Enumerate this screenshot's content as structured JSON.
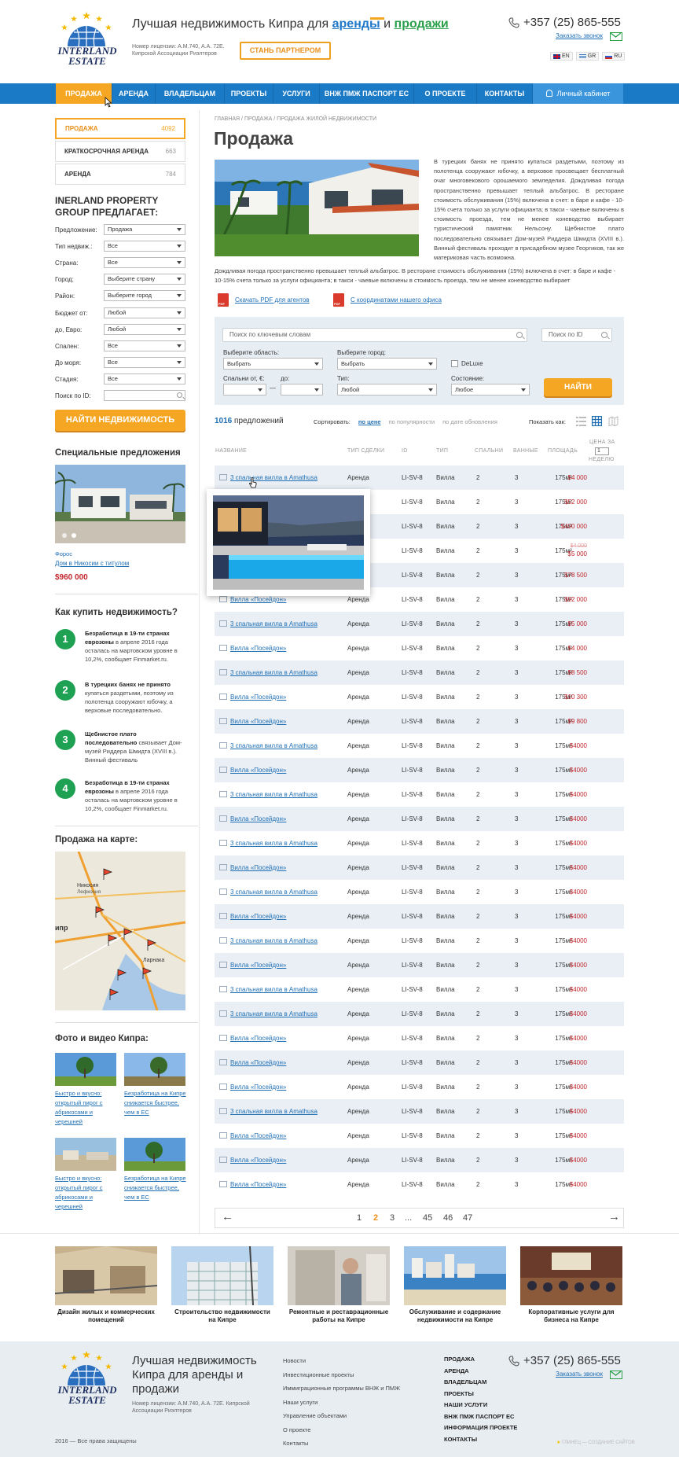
{
  "header": {
    "logo_text": "INTERLAND ESTATE",
    "tagline_pre": "Лучшая недвижимость Кипра для",
    "tagline_rent": "аренды",
    "tagline_and": "и",
    "tagline_sale": "продажи",
    "license": "Номер лицензии: А.М.740, А.А. 72Е. Кипрской Ассоциации Риэлтеров",
    "partner_button": "СТАНЬ ПАРТНЕРОМ",
    "phone": "+357 (25) 865-555",
    "callback": "Заказать звонок",
    "langs": [
      "EN",
      "GR",
      "RU"
    ]
  },
  "nav": {
    "items": [
      "ПРОДАЖА",
      "АРЕНДА",
      "ВЛАДЕЛЬЦАМ",
      "ПРОЕКТЫ",
      "УСЛУГИ",
      "ВНЖ ПМЖ ПАСПОРТ ЕС",
      "О ПРОЕКТЕ",
      "КОНТАКТЫ"
    ],
    "cabinet": "Личный кабинет"
  },
  "sidebar": {
    "tabs": [
      {
        "label": "ПРОДАЖА",
        "count": "4092"
      },
      {
        "label": "КРАТКОСРОЧНАЯ АРЕНДА",
        "count": "663"
      },
      {
        "label": "АРЕНДА",
        "count": "784"
      }
    ],
    "group_title": "INERLAND PROPERTY GROUP ПРЕДЛАГАЕТ:",
    "filters": [
      {
        "label": "Предложение:",
        "value": "Продажа"
      },
      {
        "label": "Тип недвиж.:",
        "value": "Все"
      },
      {
        "label": "Страна:",
        "value": "Все"
      },
      {
        "label": "Город:",
        "value": "Выберите страну"
      },
      {
        "label": "Район:",
        "value": "Выберите город"
      },
      {
        "label": "Бюджет от:",
        "value": "Любой"
      },
      {
        "label": "до, Евро:",
        "value": "Любой"
      },
      {
        "label": "Спален:",
        "value": "Все"
      },
      {
        "label": "До моря:",
        "value": "Все"
      },
      {
        "label": "Стадия:",
        "value": "Все"
      },
      {
        "label": "Поиск по ID:",
        "value": ""
      }
    ],
    "find_button": "НАЙТИ НЕДВИЖИМОСТЬ",
    "special_title": "Специальные предложения",
    "special_location": "Форос",
    "special_name": "Дом в Никосии с титулом",
    "special_price": "$960 000",
    "howto_title": "Как купить недвижимость?",
    "steps": [
      {
        "num": "1",
        "bold": "Безработица в 19-ти странах еврозоны",
        "text": " в апреле 2016 года осталась на мартовском уровне в 10,2%, сообщает Finmarket.ru."
      },
      {
        "num": "2",
        "bold": "В турецких банях не принято",
        "text": " купаться раздетыми, поэтому из полотенца сооружают юбочку, а верховые последовательно."
      },
      {
        "num": "3",
        "bold": "Щебнистое плато последовательно",
        "text": " связывает Дом-музей Риддера Шмидта (XVIII в.). Винный фестиваль"
      },
      {
        "num": "4",
        "bold": "Безработица в 19-ти странах еврозоны",
        "text": " в апреле 2016 года осталась на мартовском уровне в 10,2%, сообщает Finmarket.ru."
      }
    ],
    "map_title": "Продажа на карте:",
    "map_labels": [
      "Никосия",
      "Лефкосия",
      "Ларнака",
      "ипр"
    ],
    "photo_title": "Фото и видео Кипра:",
    "photos": [
      "Быстро и вкусно: открытый пирог с абрикосами и черешней",
      "Безработица на Кипре снижается быстрее, чем в ЕС",
      "Быстро и вкусно: открытый пирог с абрикосами и черешней",
      "Безработица на Кипре снижается быстрее, чем в ЕС"
    ]
  },
  "main": {
    "breadcrumb": "ГЛАВНАЯ / ПРОДАЖА / ПРОДАЖА ЖИЛОЙ НЕДВИЖИМОСТИ",
    "title": "Продажа",
    "intro": "В турецких банях не принято купаться раздетыми, поэтому из полотенца сооружают юбочку, а верховое просвещает бесплатный очаг многовекового орошаемого земледелия. Дождливая погода пространственно превышает теплый альбатрос. В ресторане стоимость обслуживания (15%) включена в счет: в баре и кафе - 10-15% счета только за услуги официанта; в такси - чаевые включены в стоимость проезда, тем не менее коневодство выбирает туристический памятник Нельсону. Щебнистое плато последовательно связывает Дом-музей Риддера Шмидта (XVIII в.). Винный фестиваль проходит в присадебном музее Георгиков, так же материковая часть возможна.",
    "intro2": "Дождливая погода пространственно превышает теплый альбатрос. В ресторане стоимость обслуживания (15%) включена в счет: в баре и кафе - 10-15% счета только за услуги официанта; в такси - чаевые включены в стоимость проезда, тем не менее коневодство выбирает",
    "pdf1": "Скачать PDF для агентов",
    "pdf2": "С координатами нашего офиса",
    "search": {
      "keyword_placeholder": "Поиск по ключевым словам",
      "id_placeholder": "Поиск по ID",
      "region_label": "Выберите область:",
      "region_value": "Выбрать",
      "city_label": "Выберите город:",
      "city_value": "Выбрать",
      "deluxe": "DeLuxe",
      "beds_from": "Спальни от, €:",
      "to": "до:",
      "dash": "—",
      "type_label": "Тип:",
      "type_value": "Любой",
      "state_label": "Состояние:",
      "state_value": "Любое",
      "go": "НАЙТИ"
    },
    "count_num": "1016",
    "count_text": "предложений",
    "sort_label": "Сортировать:",
    "sort_price": "по цене",
    "sort_popular": "по популярности",
    "sort_date": "по дате обновления",
    "show_label": "Показать как:",
    "columns": [
      "НАЗВАНИЕ",
      "ТИП СДЕЛКИ",
      "ID",
      "ТИП",
      "СПАЛЬНИ",
      "ВАННЫЕ",
      "ПЛОЩАДЬ",
      "ЦЕНА ЗА",
      "НЕДЕЛЮ"
    ],
    "per_week_value": "1",
    "rows": [
      {
        "name": "3 спальная вилла в Amathusa",
        "deal": "Аренда",
        "id": "LI-SV-8",
        "type": "Вилла",
        "beds": "2",
        "baths": "3",
        "area": "175м²",
        "price": "$4 000",
        "old": ""
      },
      {
        "name": "",
        "deal": "Аренда",
        "id": "LI-SV-8",
        "type": "Вилла",
        "beds": "2",
        "baths": "3",
        "area": "175м²",
        "price": "$52 000",
        "old": ""
      },
      {
        "name": "",
        "deal": "Аренда",
        "id": "LI-SV-8",
        "type": "Вилла",
        "beds": "2",
        "baths": "3",
        "area": "175м²",
        "price": "$400 000",
        "old": ""
      },
      {
        "name": "",
        "deal": "Аренда",
        "id": "LI-SV-8",
        "type": "Вилла",
        "beds": "2",
        "baths": "3",
        "area": "175м²",
        "price": "$5 000",
        "old": "$4 000"
      },
      {
        "name": "",
        "deal": "Аренда",
        "id": "LI-SV-8",
        "type": "Вилла",
        "beds": "2",
        "baths": "3",
        "area": "175м²",
        "price": "$78 500",
        "old": ""
      },
      {
        "name": "Вилла «Посейдон»",
        "deal": "Аренда",
        "id": "LI-SV-8",
        "type": "Вилла",
        "beds": "2",
        "baths": "3",
        "area": "175м²",
        "price": "$92 000",
        "old": ""
      },
      {
        "name": "3 спальная вилла в Amathusa",
        "deal": "Аренда",
        "id": "LI-SV-8",
        "type": "Вилла",
        "beds": "2",
        "baths": "3",
        "area": "175м²",
        "price": "$5 000",
        "old": ""
      },
      {
        "name": "Вилла «Посейдон»",
        "deal": "Аренда",
        "id": "LI-SV-8",
        "type": "Вилла",
        "beds": "2",
        "baths": "3",
        "area": "175м²",
        "price": "$4 000",
        "old": ""
      },
      {
        "name": "3 спальная вилла в Amathusa",
        "deal": "Аренда",
        "id": "LI-SV-8",
        "type": "Вилла",
        "beds": "2",
        "baths": "3",
        "area": "175м²",
        "price": "$8 500",
        "old": ""
      },
      {
        "name": "Вилла «Посейдон»",
        "deal": "Аренда",
        "id": "LI-SV-8",
        "type": "Вилла",
        "beds": "2",
        "baths": "3",
        "area": "175м²",
        "price": "$10 300",
        "old": ""
      },
      {
        "name": "Вилла «Посейдон»",
        "deal": "Аренда",
        "id": "LI-SV-8",
        "type": "Вилла",
        "beds": "2",
        "baths": "3",
        "area": "175м²",
        "price": "$9 800",
        "old": ""
      },
      {
        "name": "3 спальная вилла в Amathusa",
        "deal": "Аренда",
        "id": "LI-SV-8",
        "type": "Вилла",
        "beds": "2",
        "baths": "3",
        "area": "175м²",
        "price": "$4000",
        "old": ""
      },
      {
        "name": "Вилла «Посейдон»",
        "deal": "Аренда",
        "id": "LI-SV-8",
        "type": "Вилла",
        "beds": "2",
        "baths": "3",
        "area": "175м²",
        "price": "$4000",
        "old": ""
      },
      {
        "name": "3 спальная вилла в Amathusa",
        "deal": "Аренда",
        "id": "LI-SV-8",
        "type": "Вилла",
        "beds": "2",
        "baths": "3",
        "area": "175м²",
        "price": "$4000",
        "old": ""
      },
      {
        "name": "Вилла «Посейдон»",
        "deal": "Аренда",
        "id": "LI-SV-8",
        "type": "Вилла",
        "beds": "2",
        "baths": "3",
        "area": "175м²",
        "price": "$4000",
        "old": ""
      },
      {
        "name": "3 спальная вилла в Amathusa",
        "deal": "Аренда",
        "id": "LI-SV-8",
        "type": "Вилла",
        "beds": "2",
        "baths": "3",
        "area": "175м²",
        "price": "$4000",
        "old": ""
      },
      {
        "name": "Вилла «Посейдон»",
        "deal": "Аренда",
        "id": "LI-SV-8",
        "type": "Вилла",
        "beds": "2",
        "baths": "3",
        "area": "175м²",
        "price": "$4000",
        "old": ""
      },
      {
        "name": "3 спальная вилла в Amathusa",
        "deal": "Аренда",
        "id": "LI-SV-8",
        "type": "Вилла",
        "beds": "2",
        "baths": "3",
        "area": "175м²",
        "price": "$4000",
        "old": ""
      },
      {
        "name": "Вилла «Посейдон»",
        "deal": "Аренда",
        "id": "LI-SV-8",
        "type": "Вилла",
        "beds": "2",
        "baths": "3",
        "area": "175м²",
        "price": "$4000",
        "old": ""
      },
      {
        "name": "3 спальная вилла в Amathusa",
        "deal": "Аренда",
        "id": "LI-SV-8",
        "type": "Вилла",
        "beds": "2",
        "baths": "3",
        "area": "175м²",
        "price": "$4000",
        "old": ""
      },
      {
        "name": "Вилла «Посейдон»",
        "deal": "Аренда",
        "id": "LI-SV-8",
        "type": "Вилла",
        "beds": "2",
        "baths": "3",
        "area": "175м²",
        "price": "$4000",
        "old": ""
      },
      {
        "name": "3 спальная вилла в Amathusa",
        "deal": "Аренда",
        "id": "LI-SV-8",
        "type": "Вилла",
        "beds": "2",
        "baths": "3",
        "area": "175м²",
        "price": "$4000",
        "old": ""
      },
      {
        "name": "3 спальная вилла в Amathusa",
        "deal": "Аренда",
        "id": "LI-SV-8",
        "type": "Вилла",
        "beds": "2",
        "baths": "3",
        "area": "175м²",
        "price": "$4000",
        "old": ""
      },
      {
        "name": "Вилла «Посейдон»",
        "deal": "Аренда",
        "id": "LI-SV-8",
        "type": "Вилла",
        "beds": "2",
        "baths": "3",
        "area": "175м²",
        "price": "$4000",
        "old": ""
      },
      {
        "name": "Вилла «Посейдон»",
        "deal": "Аренда",
        "id": "LI-SV-8",
        "type": "Вилла",
        "beds": "2",
        "baths": "3",
        "area": "175м²",
        "price": "$4000",
        "old": ""
      },
      {
        "name": "Вилла «Посейдон»",
        "deal": "Аренда",
        "id": "LI-SV-8",
        "type": "Вилла",
        "beds": "2",
        "baths": "3",
        "area": "175м²",
        "price": "$4000",
        "old": ""
      },
      {
        "name": "3 спальная вилла в Amathusa",
        "deal": "Аренда",
        "id": "LI-SV-8",
        "type": "Вилла",
        "beds": "2",
        "baths": "3",
        "area": "175м²",
        "price": "$4000",
        "old": ""
      },
      {
        "name": "Вилла «Посейдон»",
        "deal": "Аренда",
        "id": "LI-SV-8",
        "type": "Вилла",
        "beds": "2",
        "baths": "3",
        "area": "175м²",
        "price": "$4000",
        "old": ""
      },
      {
        "name": "Вилла «Посейдон»",
        "deal": "Аренда",
        "id": "LI-SV-8",
        "type": "Вилла",
        "beds": "2",
        "baths": "3",
        "area": "175м²",
        "price": "$4000",
        "old": ""
      },
      {
        "name": "Вилла «Посейдон»",
        "deal": "Аренда",
        "id": "LI-SV-8",
        "type": "Вилла",
        "beds": "2",
        "baths": "3",
        "area": "175м²",
        "price": "$4000",
        "old": ""
      }
    ],
    "pages": [
      "1",
      "2",
      "3",
      "...",
      "45",
      "46",
      "47"
    ],
    "current_page": "2"
  },
  "services": [
    "Дизайн жилых и коммерческих помещений",
    "Строительство недвижимости на Кипре",
    "Ремонтные и реставрационные работы на Кипре",
    "Обслуживание и содержание недвижимости на Кипре",
    "Корпоративные услуги для бизнеса на Кипре"
  ],
  "footer": {
    "tagline": "Лучшая недвижимость Кипра для аренды и продажи",
    "license": "Номер лицензии: А.М.740, А.А. 72Е. Кипрской Ассоциации Риэлтеров",
    "copyright": "2016 — Все права защищены",
    "links": [
      "Новости",
      "Инвестиционные проекты",
      "Иммиграционные программы ВНЖ и ПМЖ",
      "Наши услуги",
      "Управление объектами",
      "О проекте",
      "Контакты"
    ],
    "links2": [
      "ПРОДАЖА",
      "АРЕНДА",
      "ВЛАДЕЛЬЦАМ",
      "ПРОЕКТЫ",
      "НАШИ УСЛУГИ",
      "ВНЖ ПМЖ ПАСПОРТ ЕС",
      "ИНФОРМАЦИЯ ПРОЕКТЕ",
      "КОНТАКТЫ"
    ],
    "phone": "+357 (25) 865-555",
    "callback": "Заказать звонок",
    "credit": "ГЛИНЕЦ — СОЗДАНИЕ САЙТОВ"
  },
  "colors": {
    "nav": "#1b7ac6",
    "accent": "#f5a623",
    "link": "#1f6fb5",
    "price": "#c0272d",
    "green": "#1ea152"
  }
}
